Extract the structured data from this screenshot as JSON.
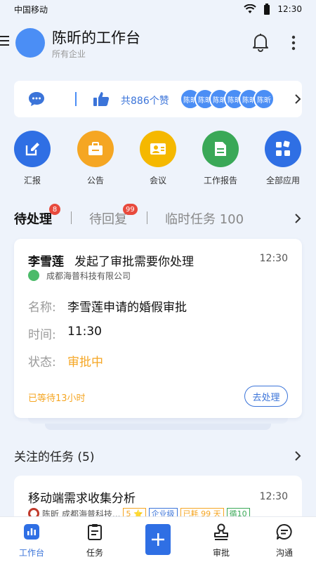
{
  "status_bar": {
    "carrier": "中国移动",
    "time": "12:30"
  },
  "header": {
    "title": "陈昕的工作台",
    "subtitle": "所有企业"
  },
  "likes": {
    "count_text": "共886个赞",
    "likers": [
      "陈昕",
      "陈昕",
      "陈昕",
      "陈昕",
      "陈昕",
      "陈昕"
    ]
  },
  "shortcuts": [
    {
      "label": "汇报",
      "icon": "edit-icon",
      "color": "#2f6fe4"
    },
    {
      "label": "公告",
      "icon": "briefcase-icon",
      "color": "#f5a623"
    },
    {
      "label": "会议",
      "icon": "meeting-icon",
      "color": "#f5b800"
    },
    {
      "label": "工作报告",
      "icon": "document-icon",
      "color": "#3aa857"
    },
    {
      "label": "全部应用",
      "icon": "grid-icon",
      "color": "#2f6fe4"
    }
  ],
  "tabs": [
    {
      "label": "待处理",
      "badge": "8"
    },
    {
      "label": "待回复",
      "badge": "99"
    },
    {
      "label": "临时任务 100",
      "badge": ""
    }
  ],
  "task_card": {
    "name": "李雪莲",
    "action": "发起了审批需要你处理",
    "time": "12:30",
    "company": "成都海普科技有限公司",
    "fields": [
      {
        "label": "名称:",
        "value": "李雪莲申请的婚假审批"
      },
      {
        "label": "时间:",
        "value": "11:30"
      },
      {
        "label": "状态:",
        "value": "审批中"
      }
    ],
    "waiting": "已等待13小时",
    "button": "去处理"
  },
  "followed": {
    "title": "关注的任务 (5)",
    "card": {
      "title": "移动端需求收集分析",
      "time": "12:30",
      "person": "陈昕",
      "company": "成都海普科技...",
      "tags": [
        {
          "text": "5 ⭐",
          "color": "#f5a623"
        },
        {
          "text": "企业级",
          "color": "#3b74d9"
        },
        {
          "text": "已耗 99 天",
          "color": "#f5a623"
        },
        {
          "text": "循10",
          "color": "#3aa857"
        }
      ]
    }
  },
  "bottom_nav": [
    {
      "label": "工作台",
      "icon": "dashboard-icon"
    },
    {
      "label": "任务",
      "icon": "task-icon"
    },
    {
      "label": "审批",
      "icon": "stamp-icon"
    },
    {
      "label": "沟通",
      "icon": "chat-icon"
    }
  ],
  "colors": {
    "primary": "#2f6fe4",
    "accent_orange": "#f5a623",
    "badge_red": "#e84a3d"
  }
}
